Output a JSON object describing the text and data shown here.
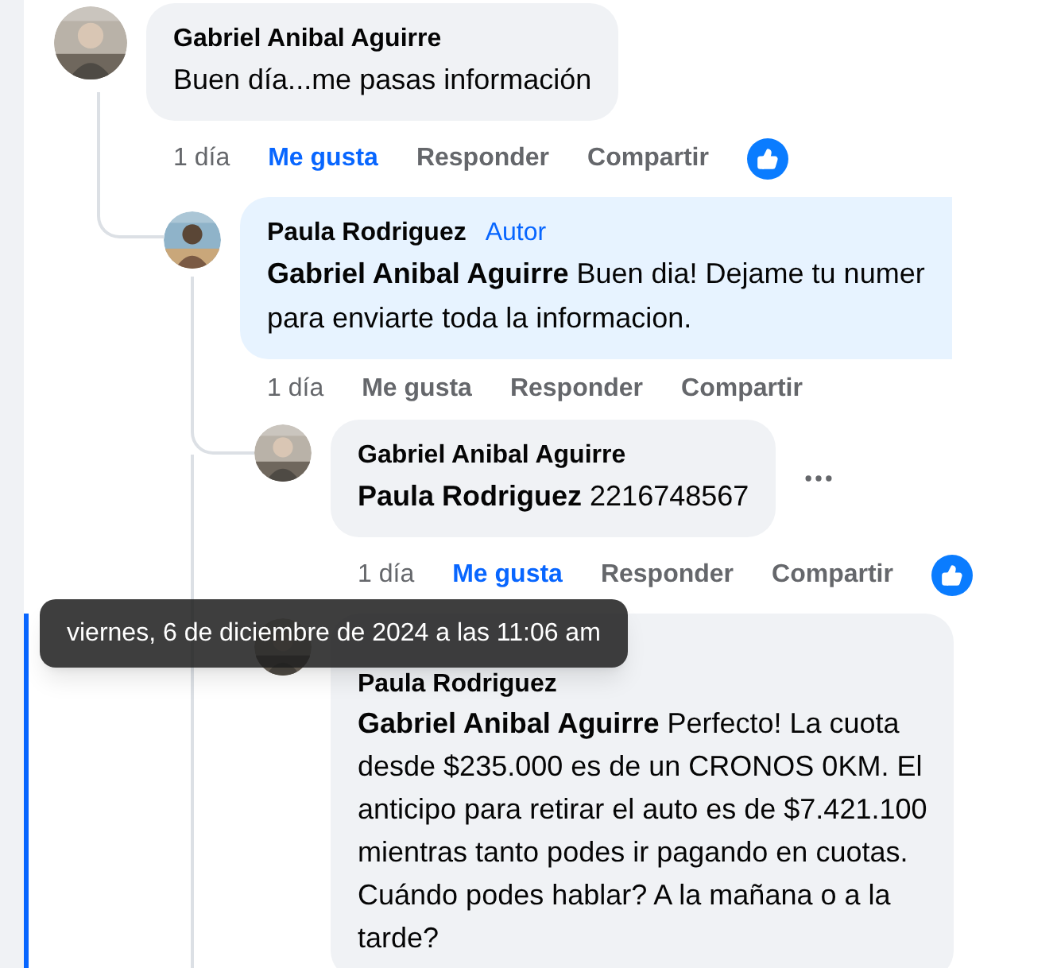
{
  "comments": [
    {
      "author": "Gabriel Anibal Aguirre",
      "lines": [
        "Buen día...me pasas información"
      ],
      "highlighted": false,
      "time": "1 día",
      "like_label": "Me gusta",
      "liked": true,
      "reply_label": "Responder",
      "share_label": "Compartir",
      "like_reaction": true,
      "more_menu": false,
      "selected": false,
      "children": [
        {
          "author": "Paula Rodriguez",
          "badge": "Autor",
          "mention": "Gabriel Anibal Aguirre",
          "lines": [
            " Buen dia! Dejame tu numer",
            "para enviarte toda la informacion."
          ],
          "highlighted": true,
          "time": "1 día",
          "like_label": "Me gusta",
          "liked": false,
          "reply_label": "Responder",
          "share_label": "Compartir",
          "like_reaction": false,
          "more_menu": false,
          "selected": false,
          "children": [
            {
              "author": "Gabriel Anibal Aguirre",
              "mention": "Paula Rodriguez",
              "lines": [
                " 2216748567"
              ],
              "highlighted": false,
              "time": "1 día",
              "like_label": "Me gusta",
              "liked": true,
              "reply_label": "Responder",
              "share_label": "Compartir",
              "like_reaction": true,
              "more_menu": true,
              "selected": false
            },
            {
              "author": "Paula Rodriguez",
              "mention": "Gabriel Anibal Aguirre",
              "lines": [
                " Perfecto! La cuota",
                "desde $235.000 es de un CRONOS 0KM. El",
                "anticipo para retirar el auto es de $7.421.100",
                "mientras tanto podes ir pagando en cuotas.",
                "Cuándo podes hablar? A la mañana o a la",
                "tarde?"
              ],
              "highlighted": false,
              "more_menu": false,
              "selected": true
            }
          ]
        }
      ]
    }
  ],
  "tooltip": {
    "text": "viernes, 6 de diciembre de 2024 a las 11:06 am"
  }
}
